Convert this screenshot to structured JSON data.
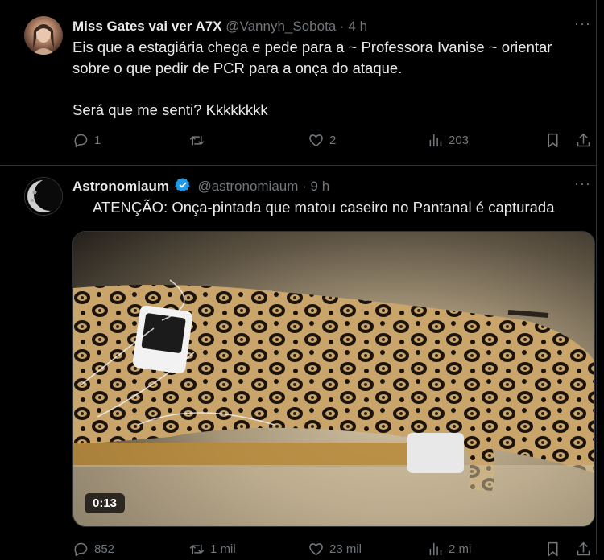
{
  "tweets": [
    {
      "name": "Miss Gates vai ver A7X",
      "handle": "@Vannyh_Sobota",
      "sep": "·",
      "time": "4 h",
      "more_icon": "more-horizontal-icon",
      "text": "Eis que a estagiária chega e pede para a ~ Professora Ivanise ~ orientar sobre o que pedir de PCR para a onça do ataque.\n\nSerá que me senti? Kkkkkkkk",
      "replies": "1",
      "retweets": "",
      "likes": "2",
      "views": "203"
    },
    {
      "name": "Astronomiaum",
      "verified": true,
      "verified_color": "#1d9bf0",
      "handle": "@astronomiaum",
      "sep": "·",
      "time": "9 h",
      "alert_icon": "rotating-light-emoji-icon",
      "text": "ATENÇÃO: Onça-pintada que matou caseiro no Pantanal é capturada",
      "video_duration": "0:13",
      "replies": "852",
      "retweets": "1 mil",
      "likes": "23 mil",
      "views": "2 mi"
    }
  ],
  "colors": {
    "background": "#000000",
    "text": "#e7e9ea",
    "secondary": "#71767b",
    "divider": "#2f3336",
    "accent": "#1d9bf0"
  }
}
